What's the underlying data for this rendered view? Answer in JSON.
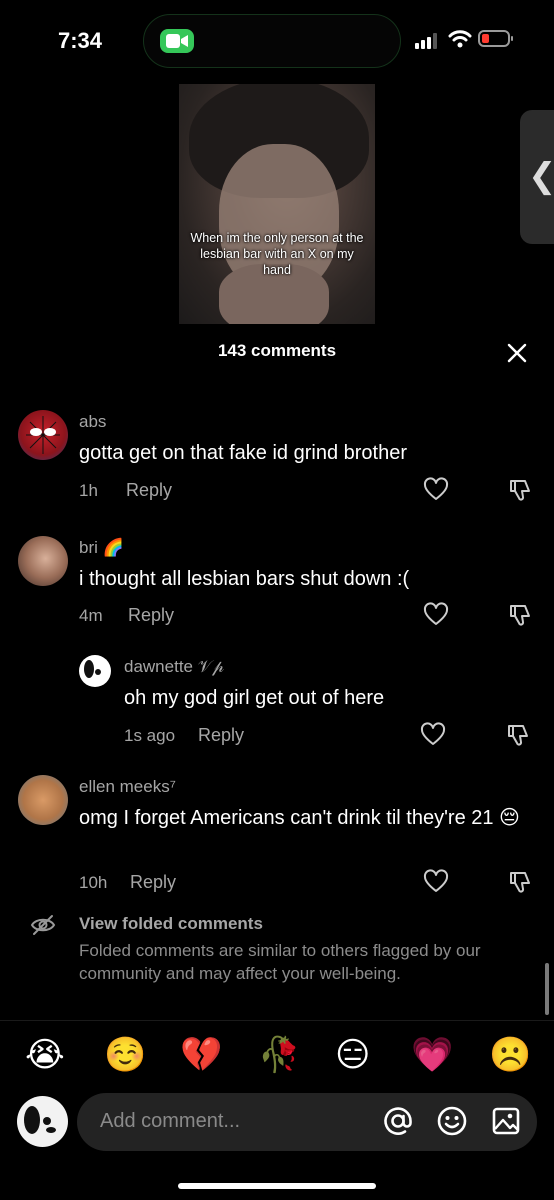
{
  "status": {
    "time": "7:34"
  },
  "video": {
    "caption": "When im the only person at the lesbian bar with an X on my hand"
  },
  "header": {
    "comment_count": "143 comments"
  },
  "comments": [
    {
      "user": "abs",
      "text": "gotta get on that fake id grind brother",
      "time": "1h",
      "reply": "Reply"
    },
    {
      "user": "bri 🌈",
      "text": "i thought all lesbian bars shut down :(",
      "time": "4m",
      "reply": "Reply"
    },
    {
      "user": "dawnette 𝒱𝓅",
      "text": "oh my god girl get out of here",
      "time": "1s ago",
      "reply": "Reply"
    },
    {
      "user": "ellen meeks⁷",
      "text": "omg I forget Americans can't drink til they're 21 😔",
      "time": "10h",
      "reply": "Reply"
    }
  ],
  "folded": {
    "title": "View folded comments",
    "description": "Folded comments are similar to others flagged by our community and may affect your well-being."
  },
  "emojis": [
    "😭",
    "☺️",
    "💔",
    "🥀",
    "😑",
    "💗",
    "☹️"
  ],
  "input": {
    "placeholder": "Add comment..."
  },
  "colors": {
    "background": "#000000",
    "secondary_text": "#a6a6a6",
    "input_bg": "#232323",
    "facetime_green": "#35c759"
  }
}
